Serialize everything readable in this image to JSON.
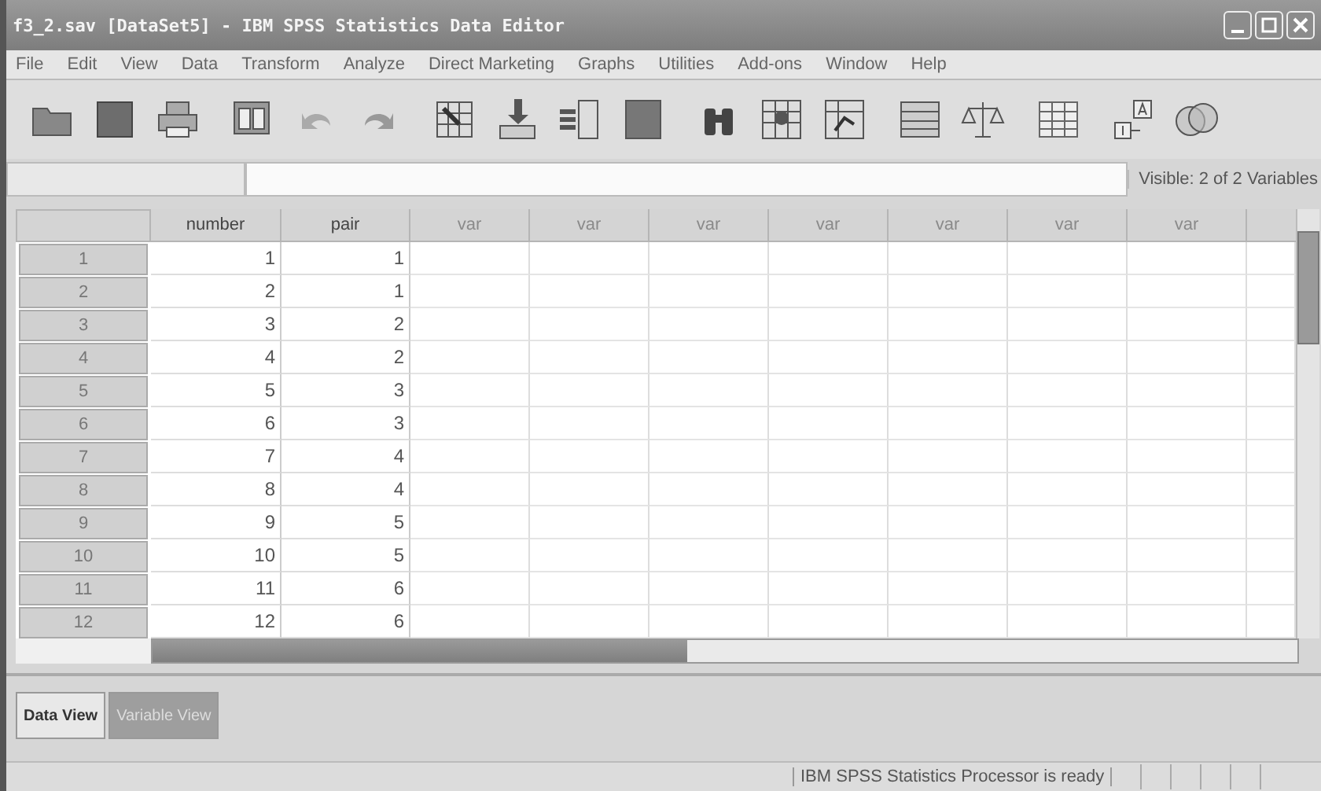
{
  "window": {
    "title": "f3_2.sav [DataSet5] - IBM SPSS Statistics Data Editor"
  },
  "menu": [
    "File",
    "Edit",
    "View",
    "Data",
    "Transform",
    "Analyze",
    "Direct Marketing",
    "Graphs",
    "Utilities",
    "Add-ons",
    "Window",
    "Help"
  ],
  "cell_bar": {
    "visible_label": "Visible: 2 of 2 Variables"
  },
  "table": {
    "columns": [
      {
        "label": "number",
        "kind": "defined"
      },
      {
        "label": "pair",
        "kind": "defined"
      },
      {
        "label": "var",
        "kind": "empty"
      },
      {
        "label": "var",
        "kind": "empty"
      },
      {
        "label": "var",
        "kind": "empty"
      },
      {
        "label": "var",
        "kind": "empty"
      },
      {
        "label": "var",
        "kind": "empty"
      },
      {
        "label": "var",
        "kind": "empty"
      },
      {
        "label": "var",
        "kind": "empty"
      }
    ],
    "rows": [
      {
        "label": "1",
        "cells": [
          "1",
          "1"
        ]
      },
      {
        "label": "2",
        "cells": [
          "2",
          "1"
        ]
      },
      {
        "label": "3",
        "cells": [
          "3",
          "2"
        ]
      },
      {
        "label": "4",
        "cells": [
          "4",
          "2"
        ]
      },
      {
        "label": "5",
        "cells": [
          "5",
          "3"
        ]
      },
      {
        "label": "6",
        "cells": [
          "6",
          "3"
        ]
      },
      {
        "label": "7",
        "cells": [
          "7",
          "4"
        ]
      },
      {
        "label": "8",
        "cells": [
          "8",
          "4"
        ]
      },
      {
        "label": "9",
        "cells": [
          "9",
          "5"
        ]
      },
      {
        "label": "10",
        "cells": [
          "10",
          "5"
        ]
      },
      {
        "label": "11",
        "cells": [
          "11",
          "6"
        ]
      },
      {
        "label": "12",
        "cells": [
          "12",
          "6"
        ]
      }
    ]
  },
  "tabs": [
    {
      "label": "Data View",
      "selected": true
    },
    {
      "label": "Variable View",
      "selected": false
    }
  ],
  "status_bar": {
    "message": "IBM SPSS Statistics Processor is ready"
  }
}
